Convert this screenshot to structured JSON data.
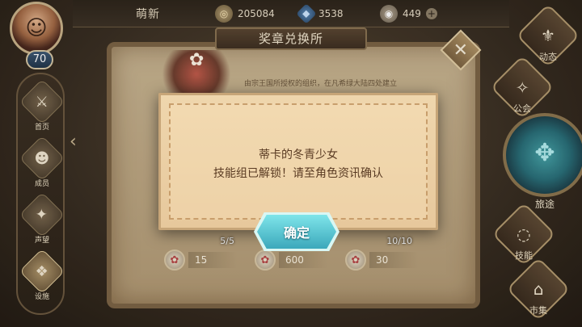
{
  "player": {
    "nickname": "萌新",
    "level": "70"
  },
  "currencies": {
    "gold": "205084",
    "gem": "3538",
    "other": "449"
  },
  "left_menu": [
    {
      "label": "首页",
      "icon": "sword-icon"
    },
    {
      "label": "成员",
      "icon": "members-icon"
    },
    {
      "label": "声望",
      "icon": "wings-icon"
    },
    {
      "label": "设施",
      "icon": "facility-icon"
    }
  ],
  "right_menu": {
    "top_label": "动态",
    "guild_label": "公会",
    "journey_label": "旅途",
    "skill_label": "技能",
    "market_label": "市集"
  },
  "shop": {
    "title": "奖章兑换所",
    "description": "由宗王国所授权的组织，在凡希绿大陆四处建立",
    "items": [
      {
        "count": "5/5",
        "price": "15"
      },
      {
        "count": "",
        "price": "600"
      },
      {
        "count": "10/10",
        "price": "30"
      }
    ]
  },
  "dialog": {
    "title": "蒂卡的冬青少女",
    "message": "技能组已解锁！请至角色资讯确认",
    "confirm_label": "确定"
  }
}
